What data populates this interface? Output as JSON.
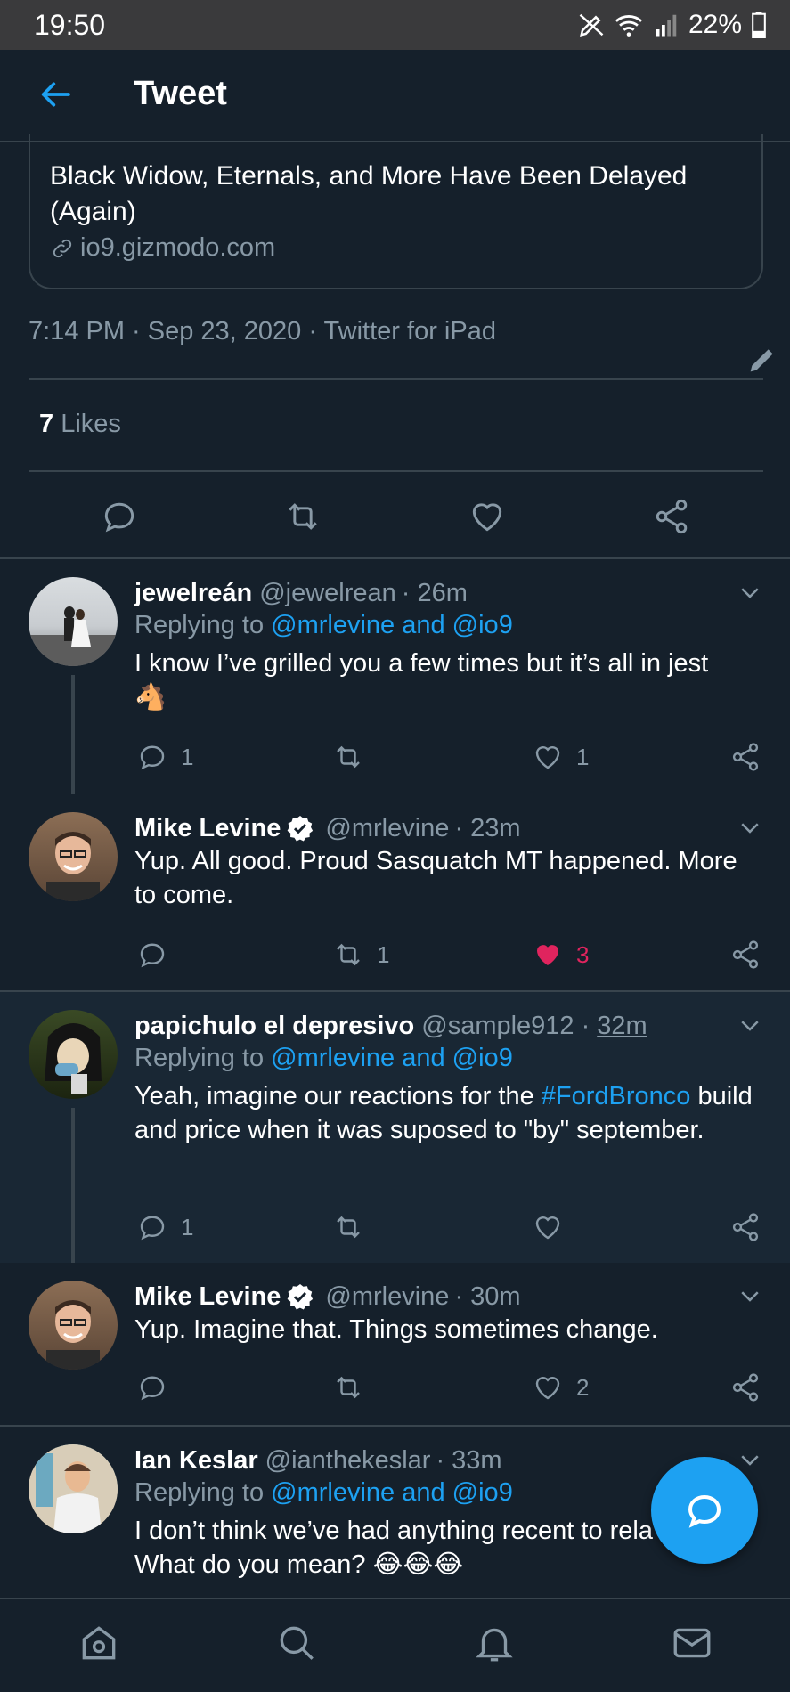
{
  "status_bar": {
    "time": "19:50",
    "battery": "22%"
  },
  "header": {
    "title": "Tweet"
  },
  "link_card": {
    "title": "Black Widow, Eternals, and More Have Been Delayed (Again)",
    "domain": "io9.gizmodo.com"
  },
  "tweet_meta": {
    "text": "7:14 PM · Sep 23, 2020 · Twitter for iPad"
  },
  "likes": {
    "count": "7",
    "label": "Likes"
  },
  "replies": [
    {
      "name": "jewelreán",
      "handle": "@jewelrean",
      "time": "· 26m",
      "replying_prefix": "Replying to ",
      "replying_to": "@mrlevine and @io9",
      "text": "I know I’ve grilled you a few times but it’s all in jest",
      "emoji": "🐴",
      "reply_count": "1",
      "retweet_count": "",
      "like_count": "1"
    },
    {
      "name": "Mike Levine",
      "handle": "@mrlevine",
      "time": "· 23m",
      "verified": true,
      "text": "Yup. All good. Proud Sasquatch MT happened. More to come.",
      "reply_count": "",
      "retweet_count": "1",
      "like_count": "3",
      "liked": true
    },
    {
      "name": "papichulo el depresivo",
      "handle": "@sample912",
      "time_prefix": "·",
      "time": "32m",
      "replying_prefix": "Replying to ",
      "replying_to": "@mrlevine and @io9",
      "text_before": "Yeah, imagine our reactions for the ",
      "hashtag": "#FordBronco",
      "text_after": " build and price when it was suposed to \"by\" september.",
      "reply_count": "1",
      "retweet_count": "",
      "like_count": ""
    },
    {
      "name": "Mike Levine",
      "handle": "@mrlevine",
      "time": "· 30m",
      "verified": true,
      "text": "Yup. Imagine that. Things sometimes change.",
      "reply_count": "",
      "retweet_count": "",
      "like_count": "2"
    },
    {
      "name": "Ian Keslar",
      "handle": "@ianthekeslar",
      "time": "· 33m",
      "replying_prefix": "Replying to ",
      "replying_to": "@mrlevine and @io9",
      "text": "I don’t think we’ve had anything recent to rela to. What do you mean? 😂😂😂"
    }
  ],
  "colors": {
    "background": "#15202b",
    "accent": "#1da1f2",
    "like": "#e0245e",
    "muted": "#8899a6"
  }
}
